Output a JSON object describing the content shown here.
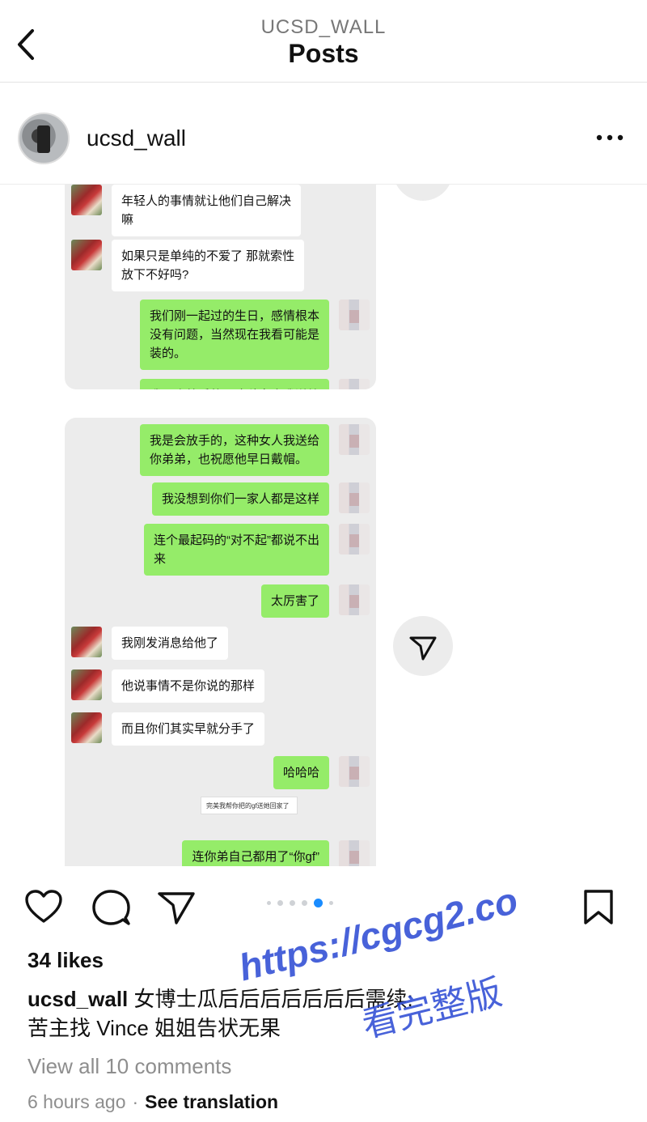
{
  "header": {
    "subtitle": "UCSD_WALL",
    "title": "Posts"
  },
  "post": {
    "username": "ucsd_wall"
  },
  "chat": {
    "panel1": [
      {
        "side": "left",
        "text": "年轻人的事情就让他们自己解决\n嘛"
      },
      {
        "side": "left",
        "text": "如果只是单纯的不爱了 那就索性\n放下不好吗?"
      },
      {
        "side": "right",
        "text": "我们刚一起过的生日，感情根本\n没有问题，当然现在我看可能是\n装的。"
      },
      {
        "side": "right",
        "text": "我是会放手的，这种女人我送给\n你弟弟，也祝愿他早日戴帽。"
      }
    ],
    "panel2": [
      {
        "side": "right",
        "text": "我是会放手的，这种女人我送给\n你弟弟，也祝愿他早日戴帽。"
      },
      {
        "side": "right",
        "text": "我没想到你们一家人都是这样"
      },
      {
        "side": "right",
        "text": "连个最起码的“对不起”都说不出\n来"
      },
      {
        "side": "right",
        "text": "太厉害了"
      },
      {
        "side": "left",
        "text": "我刚发消息给他了"
      },
      {
        "side": "left",
        "text": "他说事情不是你说的那样"
      },
      {
        "side": "left",
        "text": "而且你们其实早就分手了"
      },
      {
        "side": "right",
        "text": "哈哈哈"
      },
      {
        "side": "right",
        "text": "连你弟自己都用了“你gf”"
      }
    ],
    "mini_quote": "完美我帮你把的gf送她回家了"
  },
  "actions": {
    "carousel_count": 6,
    "carousel_active": 4
  },
  "likes": "34 likes",
  "caption": {
    "user": "ucsd_wall",
    "text": "女博士瓜后后后后后后后需续:\n苦主找 Vince 姐姐告状无果"
  },
  "comments_link": "View all 10 comments",
  "timestamp": "6 hours ago",
  "separator": "·",
  "see_translation": "See translation",
  "watermark": {
    "url": "https://cgcg2.co",
    "text": "看完整版"
  }
}
